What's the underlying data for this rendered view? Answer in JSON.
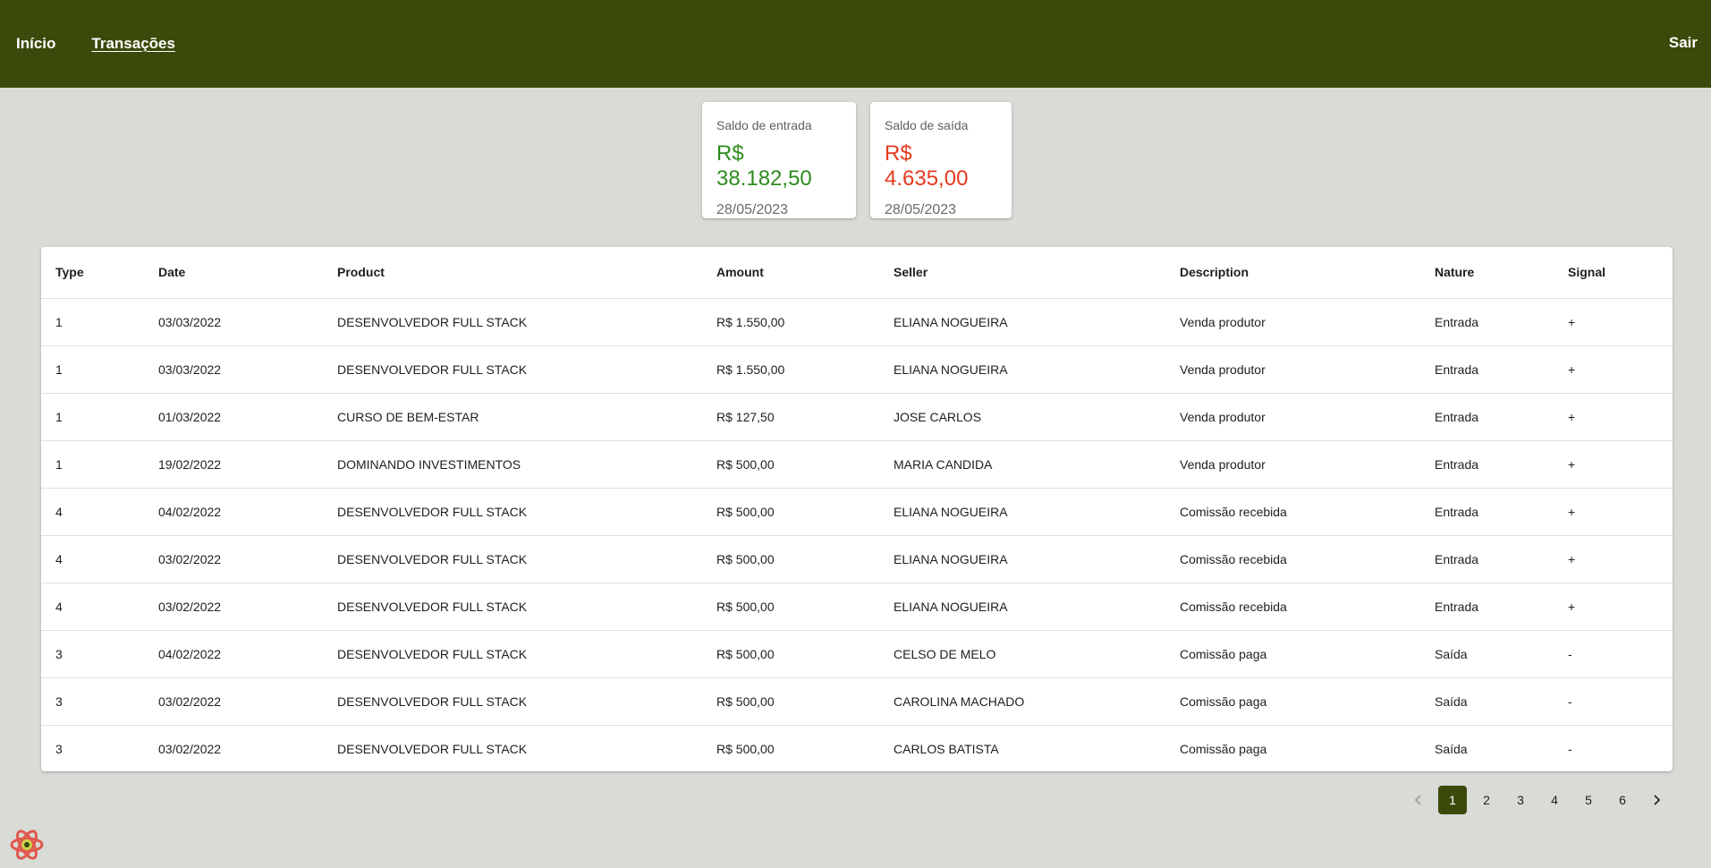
{
  "nav": {
    "home": "Início",
    "transactions": "Transações",
    "logout": "Sair"
  },
  "cards": {
    "inflow": {
      "title": "Saldo de entrada",
      "value": "R$ 38.182,50",
      "date": "28/05/2023",
      "color": "#2e8b1e"
    },
    "outflow": {
      "title": "Saldo de saída",
      "value": "R$ 4.635,00",
      "date": "28/05/2023",
      "color": "#e53a1e"
    }
  },
  "table": {
    "headers": [
      "Type",
      "Date",
      "Product",
      "Amount",
      "Seller",
      "Description",
      "Nature",
      "Signal"
    ],
    "rows": [
      [
        "1",
        "03/03/2022",
        "DESENVOLVEDOR FULL STACK",
        "R$ 1.550,00",
        "ELIANA NOGUEIRA",
        "Venda produtor",
        "Entrada",
        "+"
      ],
      [
        "1",
        "03/03/2022",
        "DESENVOLVEDOR FULL STACK",
        "R$ 1.550,00",
        "ELIANA NOGUEIRA",
        "Venda produtor",
        "Entrada",
        "+"
      ],
      [
        "1",
        "01/03/2022",
        "CURSO DE BEM-ESTAR",
        "R$ 127,50",
        "JOSE CARLOS",
        "Venda produtor",
        "Entrada",
        "+"
      ],
      [
        "1",
        "19/02/2022",
        "DOMINANDO INVESTIMENTOS",
        "R$ 500,00",
        "MARIA CANDIDA",
        "Venda produtor",
        "Entrada",
        "+"
      ],
      [
        "4",
        "04/02/2022",
        "DESENVOLVEDOR FULL STACK",
        "R$ 500,00",
        "ELIANA NOGUEIRA",
        "Comissão recebida",
        "Entrada",
        "+"
      ],
      [
        "4",
        "03/02/2022",
        "DESENVOLVEDOR FULL STACK",
        "R$ 500,00",
        "ELIANA NOGUEIRA",
        "Comissão recebida",
        "Entrada",
        "+"
      ],
      [
        "4",
        "03/02/2022",
        "DESENVOLVEDOR FULL STACK",
        "R$ 500,00",
        "ELIANA NOGUEIRA",
        "Comissão recebida",
        "Entrada",
        "+"
      ],
      [
        "3",
        "04/02/2022",
        "DESENVOLVEDOR FULL STACK",
        "R$ 500,00",
        "CELSO DE MELO",
        "Comissão paga",
        "Saída",
        "-"
      ],
      [
        "3",
        "03/02/2022",
        "DESENVOLVEDOR FULL STACK",
        "R$ 500,00",
        "CAROLINA MACHADO",
        "Comissão paga",
        "Saída",
        "-"
      ],
      [
        "3",
        "03/02/2022",
        "DESENVOLVEDOR FULL STACK",
        "R$ 500,00",
        "CARLOS BATISTA",
        "Comissão paga",
        "Saída",
        "-"
      ]
    ]
  },
  "pagination": {
    "pages": [
      "1",
      "2",
      "3",
      "4",
      "5",
      "6"
    ],
    "current": "1",
    "prev_icon": "chevron-left-icon",
    "next_icon": "chevron-right-icon"
  },
  "fab_icon": "react-devtools-icon",
  "colors": {
    "appbar": "#3b4a0a",
    "background": "#d9dbd6"
  }
}
